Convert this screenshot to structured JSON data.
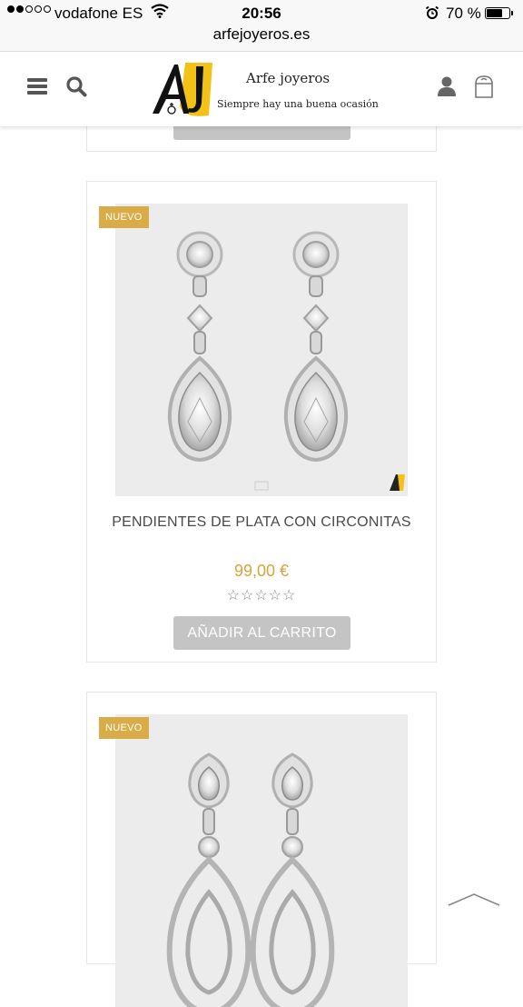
{
  "status_bar": {
    "carrier": "vodafone ES",
    "time": "20:56",
    "battery": "70 %",
    "battery_level": 0.7,
    "url": "arfejoyeros.es"
  },
  "header": {
    "brand": "Arfe joyeros",
    "tagline": "Siempre hay una buena ocasión",
    "icons": [
      "menu-icon",
      "search-icon",
      "user-icon",
      "shopping-bag-icon"
    ]
  },
  "products": [
    {
      "badge": "NUEVO",
      "title": "PENDIENTES DE PLATA CON CIRCONITAS",
      "price": "99,00 €",
      "rating": 0,
      "rating_stars": "☆☆☆☆☆",
      "button": "AÑADIR AL CARRITO"
    },
    {
      "badge": "NUEVO"
    }
  ],
  "colors": {
    "accent": "#d9ac47",
    "price": "#d9a23c",
    "button": "#c4c4c4"
  }
}
